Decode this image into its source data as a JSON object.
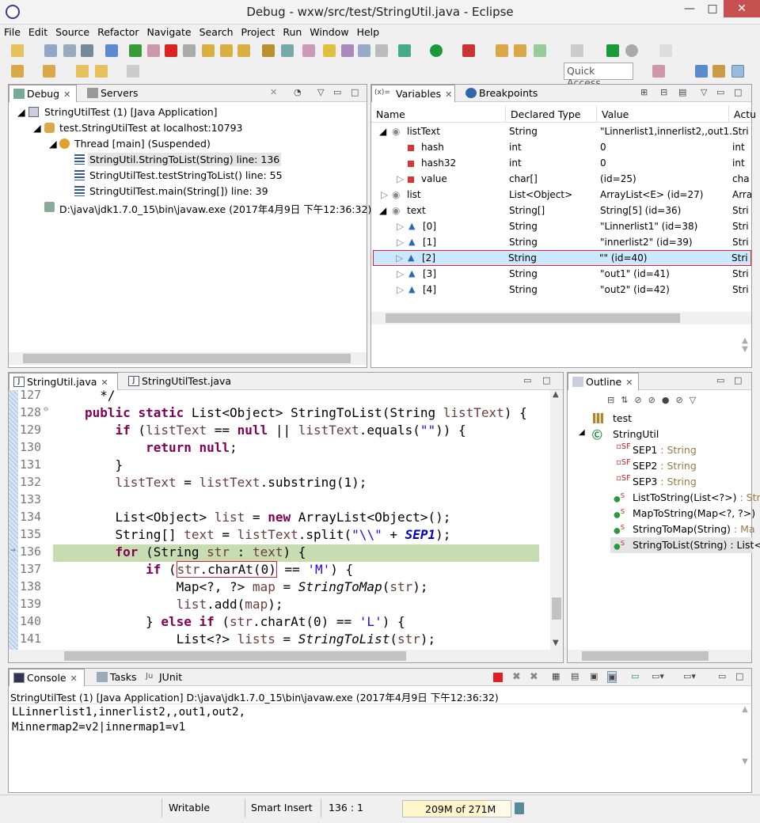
{
  "window": {
    "title": "Debug - wxw/src/test/StringUtil.java - Eclipse"
  },
  "menu": [
    "File",
    "Edit",
    "Source",
    "Refactor",
    "Navigate",
    "Search",
    "Project",
    "Run",
    "Window",
    "Help"
  ],
  "quick_access": {
    "placeholder": "Quick Access"
  },
  "debug_view": {
    "tabs": [
      "Debug",
      "Servers"
    ],
    "tree": [
      "StringUtilTest (1) [Java Application]",
      "test.StringUtilTest at localhost:10793",
      "Thread [main] (Suspended)",
      "StringUtil.StringToList(String) line: 136",
      "StringUtilTest.testStringToList() line: 55",
      "StringUtilTest.main(String[]) line: 39",
      "D:\\java\\jdk1.7.0_15\\bin\\javaw.exe (2017年4月9日 下午12:36:32)"
    ]
  },
  "variables_view": {
    "tabs": [
      "Variables",
      "Breakpoints"
    ],
    "columns": [
      "Name",
      "Declared Type",
      "Value",
      "Actu"
    ],
    "rows": [
      {
        "name": "listText",
        "type": "String",
        "value": "\"Linnerlist1,innerlist2,,out1...",
        "actual": "Stri"
      },
      {
        "name": "hash",
        "type": "int",
        "value": "0",
        "actual": "int"
      },
      {
        "name": "hash32",
        "type": "int",
        "value": "0",
        "actual": "int"
      },
      {
        "name": "value",
        "type": "char[]",
        "value": "(id=25)",
        "actual": "cha"
      },
      {
        "name": "list",
        "type": "List<Object>",
        "value": "ArrayList<E>  (id=27)",
        "actual": "Arra"
      },
      {
        "name": "text",
        "type": "String[]",
        "value": "String[5]  (id=36)",
        "actual": "Stri"
      },
      {
        "name": "[0]",
        "type": "String",
        "value": "\"Linnerlist1\" (id=38)",
        "actual": "Stri"
      },
      {
        "name": "[1]",
        "type": "String",
        "value": "\"innerlist2\" (id=39)",
        "actual": "Stri"
      },
      {
        "name": "[2]",
        "type": "String",
        "value": "\"\" (id=40)",
        "actual": "Stri"
      },
      {
        "name": "[3]",
        "type": "String",
        "value": "\"out1\" (id=41)",
        "actual": "Stri"
      },
      {
        "name": "[4]",
        "type": "String",
        "value": "\"out2\" (id=42)",
        "actual": "Stri"
      }
    ]
  },
  "editor": {
    "tabs": [
      "StringUtil.java",
      "StringUtilTest.java"
    ],
    "line_numbers": [
      "127",
      "128",
      "129",
      "130",
      "131",
      "132",
      "133",
      "134",
      "135",
      "136",
      "137",
      "138",
      "139",
      "140",
      "141"
    ]
  },
  "outline_view": {
    "tab": "Outline",
    "items": [
      {
        "name": "test",
        "type": ""
      },
      {
        "name": "StringUtil",
        "type": ""
      },
      {
        "name": "SEP1",
        "type": " : String"
      },
      {
        "name": "SEP2",
        "type": " : String"
      },
      {
        "name": "SEP3",
        "type": " : String"
      },
      {
        "name": "ListToString(List<?>)",
        "type": " : Stri"
      },
      {
        "name": "MapToString(Map<?, ?>)",
        "type": ""
      },
      {
        "name": "StringToMap(String)",
        "type": " : Ma"
      },
      {
        "name": "StringToList(String)",
        "type": " : List<"
      }
    ]
  },
  "console_view": {
    "tabs": [
      "Console",
      "Tasks",
      "JUnit"
    ],
    "header": "StringUtilTest (1) [Java Application] D:\\java\\jdk1.7.0_15\\bin\\javaw.exe (2017年4月9日 下午12:36:32)",
    "lines": [
      "LLinnerlist1,innerlist2,,out1,out2,",
      "Minnermap2=v2|innermap1=v1"
    ]
  },
  "status_bar": {
    "writable": "Writable",
    "insert": "Smart Insert",
    "position": "136 : 1",
    "heap": "209M of 271M"
  }
}
